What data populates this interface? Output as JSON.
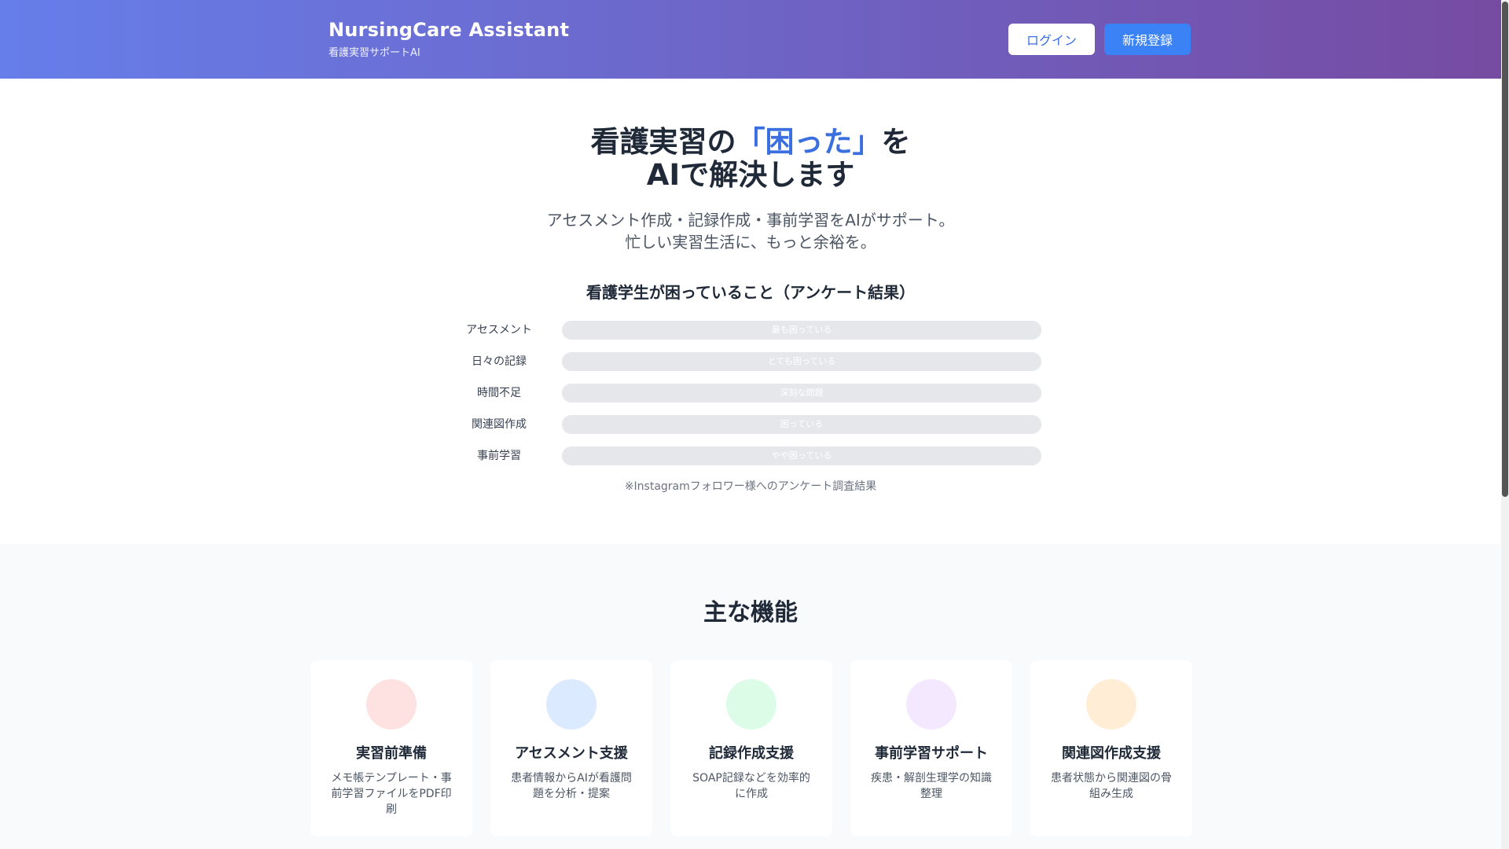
{
  "header": {
    "brand_title": "NursingCare Assistant",
    "brand_sub": "看護実習サポートAI",
    "login_label": "ログイン",
    "signup_label": "新規登録",
    "gradient_start": "#667eea",
    "gradient_end": "#764ba2"
  },
  "hero": {
    "title_part1": "看護実習の",
    "title_accent": "「困った」",
    "title_part2": "を",
    "title_line2": "AIで解決します",
    "desc_line1": "アセスメント作成・記録作成・事前学習をAIがサポート。",
    "desc_line2": "忙しい実習生活に、もっと余裕を。",
    "accent_color": "#3b6fe0"
  },
  "survey": {
    "title": "看護学生が困っていること（アンケート結果）",
    "items": [
      {
        "label": "アセスメント",
        "bar_text": "最も困っている",
        "fill": 1.0
      },
      {
        "label": "日々の記録",
        "bar_text": "とても困っている",
        "fill": 1.0
      },
      {
        "label": "時間不足",
        "bar_text": "深刻な問題",
        "fill": 1.0
      },
      {
        "label": "関連図作成",
        "bar_text": "困っている",
        "fill": 1.0
      },
      {
        "label": "事前学習",
        "bar_text": "やや困っている",
        "fill": 1.0
      }
    ],
    "note": "※Instagramフォロワー様へのアンケート調査結果"
  },
  "features": {
    "title": "主な機能",
    "cards": [
      {
        "title": "実習前準備",
        "desc": "メモ帳テンプレート・事前学習ファイルをPDF印刷",
        "color": "#fee2e2"
      },
      {
        "title": "アセスメント支援",
        "desc": "患者情報からAIが看護問題を分析・提案",
        "color": "#dbeafe"
      },
      {
        "title": "記録作成支援",
        "desc": "SOAP記録などを効率的に作成",
        "color": "#dcfce7"
      },
      {
        "title": "事前学習サポート",
        "desc": "疾患・解剖生理学の知識整理",
        "color": "#f3e8ff"
      },
      {
        "title": "関連図作成支援",
        "desc": "患者状態から関連図の骨組み生成",
        "color": "#ffedd5"
      }
    ]
  }
}
